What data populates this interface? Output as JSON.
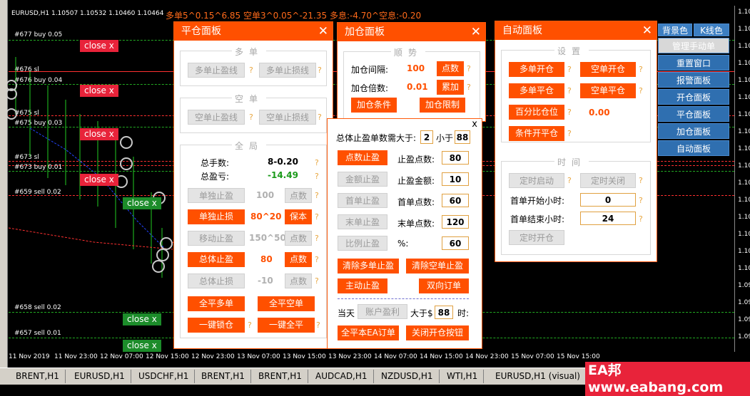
{
  "chart": {
    "symbol_header": "EURUSD,H1  1.10507 1.10532 1.10460 1.10464",
    "summary": "多单5^0.15^6.85  空单3^0.05^-21.35  多息:-4.70^空息:-0.20",
    "levels": [
      "#677 buy 0.05",
      "#676 sl",
      "#676 buy 0.04",
      "#675 sl",
      "#675 buy 0.03",
      "#673 sl",
      "#673 buy 0.01",
      "#659 sell 0.02",
      "#658 sell 0.02",
      "#657 sell 0.01"
    ],
    "tags": [
      "close x",
      "close x",
      "close x",
      "close x",
      "close x",
      "close x",
      "close x"
    ],
    "price_ticks": [
      "1.10",
      "1.10",
      "1.10",
      "1.10",
      "1.10",
      "1.10",
      "1.10",
      "1.10",
      "1.10",
      "1.10",
      "1.10",
      "1.10",
      "1.10",
      "1.10",
      "1.10",
      "1.10",
      "1.09",
      "1.09",
      "1.09",
      "1.09"
    ],
    "time_ticks": [
      "11 Nov 2019",
      "11 Nov 23:00",
      "12 Nov 07:00",
      "12 Nov 15:00",
      "12 Nov 23:00",
      "13 Nov 07:00",
      "13 Nov 15:00",
      "13 Nov 23:00",
      "14 Nov 07:00",
      "14 Nov 15:00",
      "14 Nov 23:00",
      "15 Nov 07:00",
      "15 Nov 15:00"
    ]
  },
  "close_panel": {
    "title": "平仓面板",
    "long_group": "多单",
    "long_tp": "多单止盈线",
    "long_sl": "多单止损线",
    "short_group": "空单",
    "short_tp": "空单止盈线",
    "short_sl": "空单止损线",
    "global_group": "全局",
    "total_lots_label": "总手数:",
    "total_lots_value": "8-0.20",
    "total_pl_label": "总盈亏:",
    "total_pl_value": "-14.49",
    "single_tp": "单独止盈",
    "single_tp_val": "100",
    "points1": "点数",
    "single_sl": "单独止损",
    "single_sl_val": "80^20",
    "breakeven": "保本",
    "move_tp": "移动止盈",
    "move_tp_val": "150^50",
    "points2": "点数",
    "total_tp": "总体止盈",
    "total_tp_val": "80",
    "points3": "点数",
    "total_sl": "总体止损",
    "total_sl_val": "-10",
    "points4": "点数",
    "close_all_long": "全平多单",
    "close_all_short": "全平空单",
    "lock": "一键锁仓",
    "close_all": "一键全平",
    "q": "?"
  },
  "add_panel": {
    "title": "加仓面板",
    "group": "顺势",
    "interval_label": "加仓间隔:",
    "interval_value": "100",
    "points": "点数",
    "multiple_label": "加仓倍数:",
    "multiple_value": "0.01",
    "accumulate": "累加",
    "condition": "加仓条件",
    "limit": "加仓限制"
  },
  "tp_popup": {
    "close": "x",
    "count_label": "总体止盈单数需大于:",
    "count_value": "2",
    "less_label": "小于",
    "less_value": "88",
    "points_tp": "点数止盈",
    "tp_points_label": "止盈点数:",
    "tp_points_value": "80",
    "amount_tp": "金额止盈",
    "tp_amount_label": "止盈金额:",
    "tp_amount_value": "10",
    "first_tp": "首单止盈",
    "first_points_label": "首单点数:",
    "first_points_value": "60",
    "last_tp": "末单止盈",
    "last_points_label": "末单点数:",
    "last_points_value": "120",
    "ratio_tp": "比例止盈",
    "pct_label": "%:",
    "pct_value": "60",
    "clear_long_tp": "清除多单止盈",
    "clear_short_tp": "清除空单止盈",
    "active_tp": "主动止盈",
    "two_way": "双向订单",
    "today_label": "当天",
    "account_profit": "账户盈利",
    "greater_label": "大于$",
    "greater_value": "88",
    "colon": "时:",
    "close_ea_orders": "全平本EA订单",
    "close_open_btn": "关闭开仓按钮"
  },
  "auto_panel": {
    "title": "自动面板",
    "settings_group": "设置",
    "long_open": "多单开仓",
    "short_open": "空单开仓",
    "long_close": "多单平仓",
    "short_close": "空单平仓",
    "pct_close": "百分比仓位",
    "pct_value": "0.00",
    "cond_close": "条件开平仓",
    "time_group": "时间",
    "timer_start": "定时启动",
    "timer_close": "定时关闭",
    "first_start_label": "首单开始小时:",
    "first_start_value": "0",
    "first_end_label": "首单结束小时:",
    "first_end_value": "24",
    "timer_open": "定时开仓"
  },
  "right_menu": {
    "bg_color": "背景色",
    "kline_color": "K线色",
    "manage": "管理手动单",
    "reset": "重置窗口",
    "order_panel": "报警面板",
    "open_panel": "开仓面板",
    "close_panel": "平仓面板",
    "add_panel": "加仓面板",
    "auto_panel": "自动面板"
  },
  "tabs": [
    "BRENT,H1",
    "EURUSD,H1",
    "USDCHF,H1",
    "BRENT,H1",
    "BRENT,H1",
    "AUDCAD,H1",
    "NZDUSD,H1",
    "WTI,H1",
    "EURUSD,H1 (visual)"
  ],
  "watermark": "EA邦 www.eabang.com"
}
